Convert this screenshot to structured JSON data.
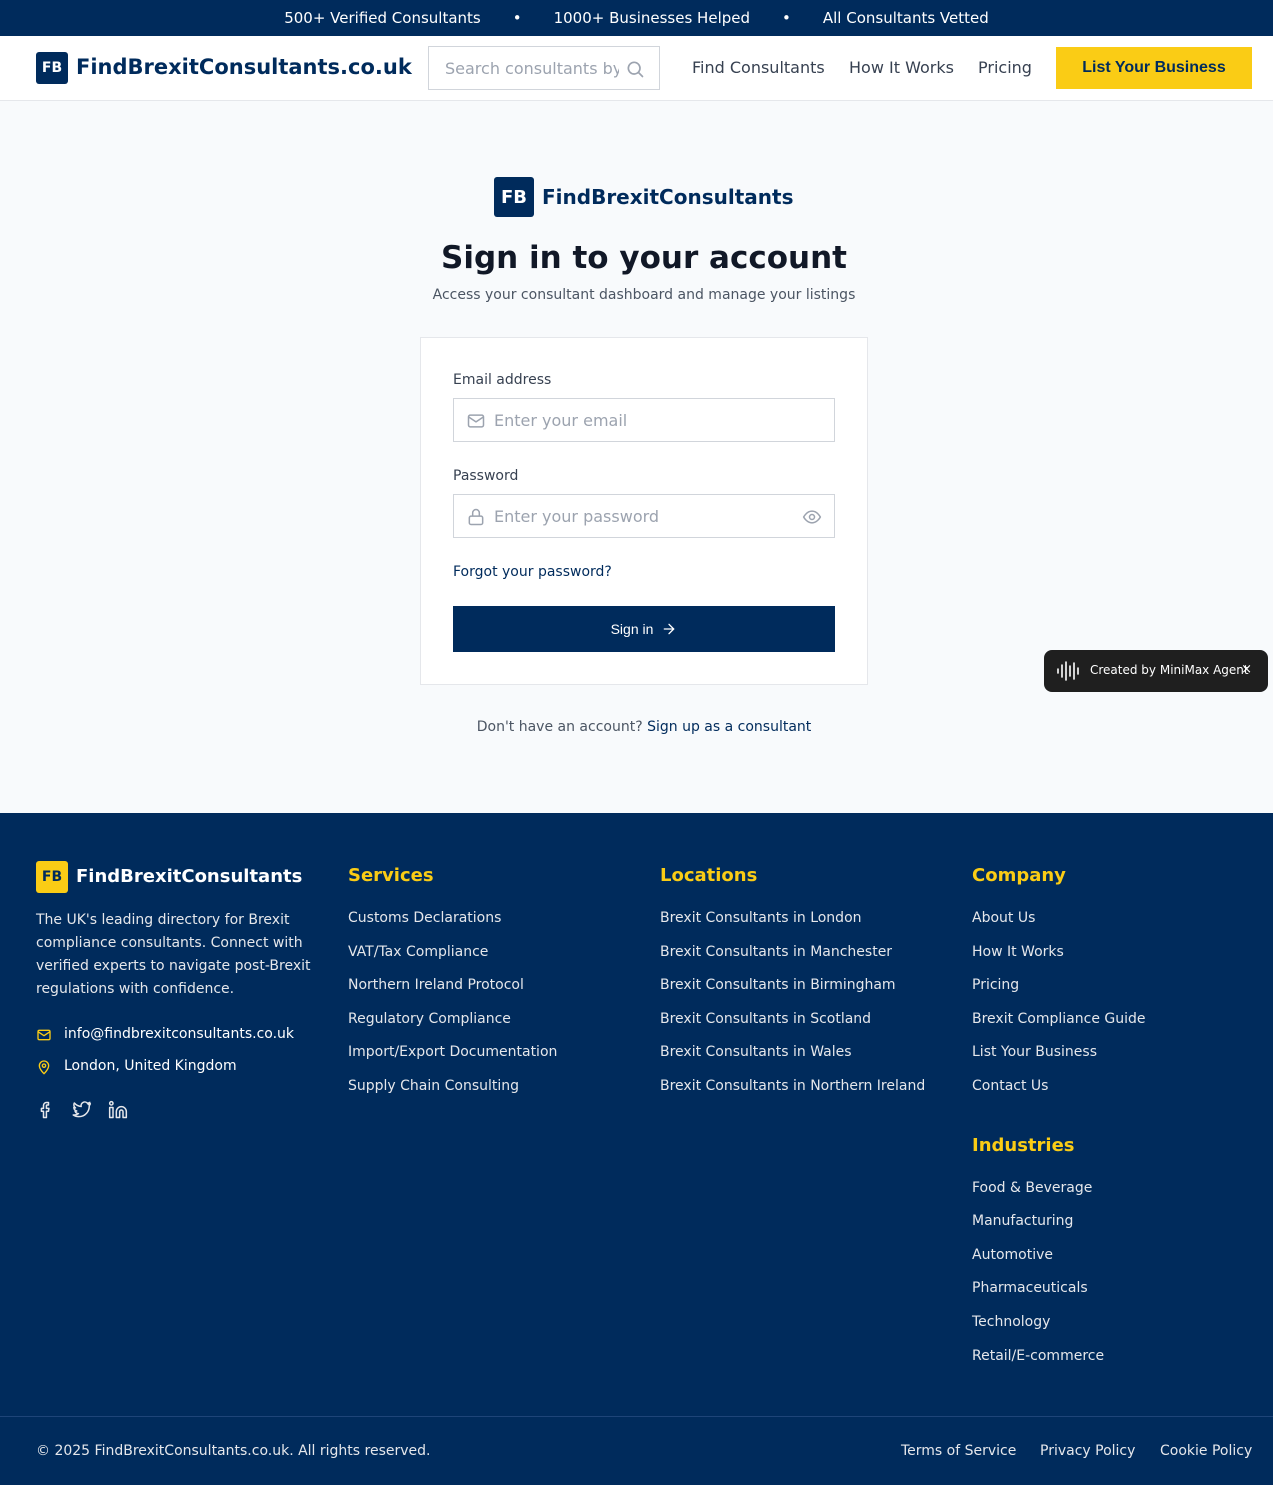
{
  "topbar": {
    "items": [
      "500+ Verified Consultants",
      "1000+ Businesses Helped",
      "All Consultants Vetted"
    ],
    "separator": "•"
  },
  "header": {
    "logo_badge": "FB",
    "logo_text": "FindBrexitConsultants.co.uk",
    "search_placeholder": "Search consultants by",
    "nav": [
      "Find Consultants",
      "How It Works",
      "Pricing"
    ],
    "cta": "List Your Business"
  },
  "main": {
    "brand_badge": "FB",
    "brand_text": "FindBrexitConsultants",
    "title": "Sign in to your account",
    "subtitle": "Access your consultant dashboard and manage your listings",
    "email_label": "Email address",
    "email_placeholder": "Enter your email",
    "password_label": "Password",
    "password_placeholder": "Enter your password",
    "forgot": "Forgot your password?",
    "signin": "Sign in",
    "signup_prompt": "Don't have an account?",
    "signup_link": "Sign up as a consultant"
  },
  "minimax": {
    "text": "Created by MiniMax Agent",
    "close": "×"
  },
  "footer": {
    "badge": "FB",
    "brand": "FindBrexitConsultants",
    "description": "The UK's leading directory for Brexit compliance consultants. Connect with verified experts to navigate post-Brexit regulations with confidence.",
    "email": "info@findbrexitconsultants.co.uk",
    "location": "London, United Kingdom",
    "services": {
      "heading": "Services",
      "links": [
        "Customs Declarations",
        "VAT/Tax Compliance",
        "Northern Ireland Protocol",
        "Regulatory Compliance",
        "Import/Export Documentation",
        "Supply Chain Consulting"
      ]
    },
    "locations": {
      "heading": "Locations",
      "links": [
        "Brexit Consultants in London",
        "Brexit Consultants in Manchester",
        "Brexit Consultants in Birmingham",
        "Brexit Consultants in Scotland",
        "Brexit Consultants in Wales",
        "Brexit Consultants in Northern Ireland"
      ]
    },
    "company": {
      "heading": "Company",
      "links": [
        "About Us",
        "How It Works",
        "Pricing",
        "Brexit Compliance Guide",
        "List Your Business",
        "Contact Us"
      ]
    },
    "industries": {
      "heading": "Industries",
      "links": [
        "Food & Beverage",
        "Manufacturing",
        "Automotive",
        "Pharmaceuticals",
        "Technology",
        "Retail/E-commerce"
      ]
    },
    "copyright": "© 2025 FindBrexitConsultants.co.uk. All rights reserved.",
    "legal": [
      "Terms of Service",
      "Privacy Policy",
      "Cookie Policy"
    ]
  },
  "colors": {
    "navy": "#002b5c",
    "yellow": "#facc15",
    "page_bg": "#f8fafc"
  },
  "icons": [
    "search-icon",
    "mail-icon",
    "lock-icon",
    "eye-icon",
    "arrow-right-icon",
    "soundwave-icon",
    "close-icon",
    "map-pin-icon",
    "facebook-icon",
    "twitter-icon",
    "linkedin-icon"
  ]
}
